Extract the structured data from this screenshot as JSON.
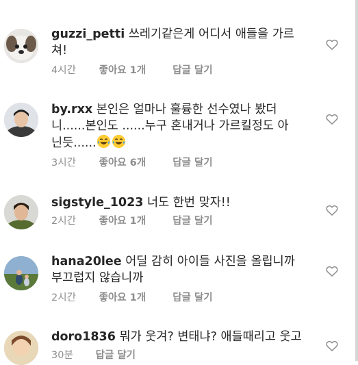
{
  "comments": [
    {
      "username": "guzzi_petti",
      "lines": [
        "쓰레기같은게 어디서 애들을 가르",
        "쳐!"
      ],
      "time": "4시간",
      "likes": "좋아요 1개",
      "reply": "답글 달기"
    },
    {
      "username": "by.rxx",
      "lines": [
        "본인은 얼마나 훌륭한 선수였나 봤더",
        "니......본인도 ......누구 혼내거나 가르킬정도 아",
        "닌듯......"
      ],
      "time": "3시간",
      "likes": "좋아요 6개",
      "reply": "답글 달기"
    },
    {
      "username": "sigstyle_1023",
      "lines": [
        "너도 한번 맞자!!"
      ],
      "time": "2시간",
      "likes": "좋아요 1개",
      "reply": "답글 달기"
    },
    {
      "username": "hana20lee",
      "lines": [
        "어딜 감히 아이들 사진을 올립니까",
        "부끄럽지 않습니까"
      ],
      "time": "2시간",
      "likes": "좋아요 1개",
      "reply": "답글 달기"
    },
    {
      "username": "doro1836",
      "lines": [
        "뭐가 웃겨? 변태냐? 애들때리고 웃고"
      ],
      "time": "30분",
      "reply": "답글 달기"
    }
  ],
  "icons": {
    "like": "heart-outline-icon",
    "emoji": "tears-of-joy-emoji"
  },
  "colors": {
    "text": "#262626",
    "meta": "#8e8e8e",
    "background": "#ffffff"
  }
}
